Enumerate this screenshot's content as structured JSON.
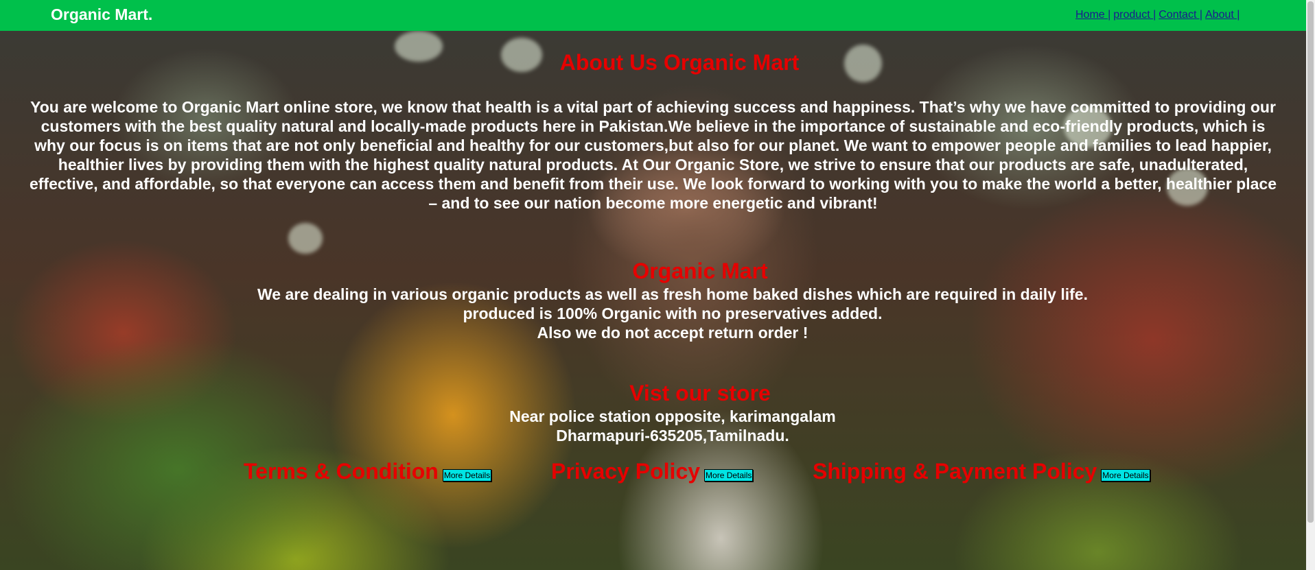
{
  "navbar": {
    "brand": "Organic Mart.",
    "links": [
      "Home |",
      "product |",
      "Contact |",
      "About |"
    ],
    "bg_color": "#00c04b"
  },
  "about": {
    "title": "About Us Organic Mart",
    "lines": [
      "You are welcome to Organic Mart online store, we know that health is a vital part of achieving success and happiness. That’s why we have committed to providing our",
      "customers with the best quality natural and locally-made products here in Pakistan.We believe in the importance of sustainable and eco-friendly products, which is",
      "why our focus is on items that are not only beneficial and healthy for our customers,but also for our planet. We want to empower people and families to lead happier,",
      "healthier lives by providing them with the highest quality natural products. At Our Organic Store, we strive to ensure that our products are safe, unadulterated,",
      "effective, and affordable, so that everyone can access them and benefit from their use. We look forward to working with you to make the world a better, healthier place",
      "– and to see our nation become more energetic and vibrant!"
    ]
  },
  "mart": {
    "title": "Organic Mart",
    "lines": [
      "We are dealing in various organic products as well as fresh home baked dishes which are required in daily life.",
      "produced is 100% Organic with no preservatives added.",
      "Also we do not accept return order !"
    ]
  },
  "store": {
    "title": "Vist our store",
    "lines": [
      "Near police station opposite, karimangalam",
      "Dharmapuri-635205,Tamilnadu."
    ]
  },
  "policies": [
    {
      "title": "Terms & Condition",
      "button": "More Details"
    },
    {
      "title": "Privacy Policy",
      "button": "More Details"
    },
    {
      "title": "Shipping & Payment Policy",
      "button": "More Details"
    }
  ],
  "colors": {
    "heading": "#e60000",
    "button": "#00e5e5",
    "link": "#1a1a8f"
  }
}
